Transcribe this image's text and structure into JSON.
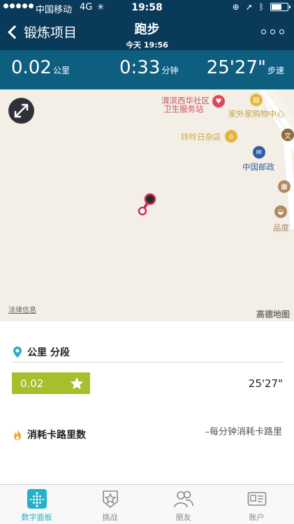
{
  "status_bar": {
    "carrier": "中国移动",
    "network": "4G",
    "time": "19:58"
  },
  "nav": {
    "back_label": "锻炼项目",
    "title": "跑步",
    "subtitle": "今天 19:56"
  },
  "stats": {
    "distance_value": "0.02",
    "distance_unit": "公里",
    "duration_value": "0:33",
    "duration_unit": "分钟",
    "pace_value": "25'27\"",
    "pace_unit": "步速"
  },
  "map": {
    "pois": [
      {
        "label": "渭滨西华社区",
        "color": "#d94a5a"
      },
      {
        "label": "卫生服务站",
        "color": "#d94a5a"
      },
      {
        "label": "家外家购物中心",
        "color": "#c9a43a"
      },
      {
        "label": "玲玲日杂店",
        "color": "#c9a43a"
      },
      {
        "label": "中国邮政",
        "color": "#2e5fa8"
      },
      {
        "label": "品度",
        "color": "#a88a6a"
      }
    ],
    "legal_link": "法律信息",
    "logo": "高德地图"
  },
  "splits": {
    "header": "公里 分段",
    "rows": [
      {
        "distance": "0.02",
        "pace": "25'27\""
      }
    ]
  },
  "calories": {
    "header": "消耗卡路里数",
    "note": "–每分钟消耗卡路里"
  },
  "tabbar": {
    "items": [
      {
        "label": "数字面板",
        "active": true
      },
      {
        "label": "挑战",
        "active": false
      },
      {
        "label": "朋友",
        "active": false
      },
      {
        "label": "账户",
        "active": false
      }
    ]
  },
  "colors": {
    "nav_bg": "#0a3a5a",
    "stats_bg": "#0e5e80",
    "split_bar": "#a7bf2c",
    "accent": "#27b0c6",
    "route": "#d42d5a"
  }
}
